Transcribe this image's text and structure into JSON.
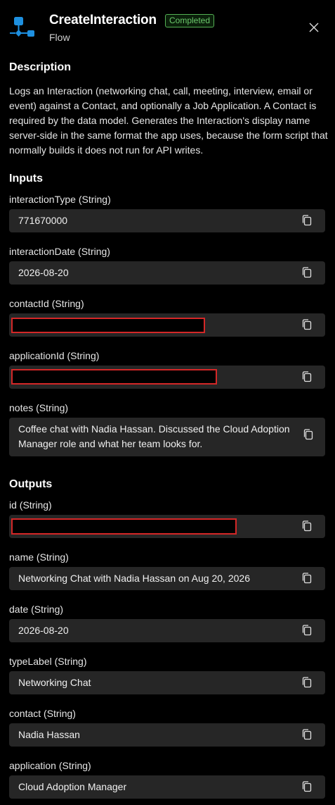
{
  "header": {
    "title": "CreateInteraction",
    "status": "Completed",
    "subtitle": "Flow",
    "icon": "flow-icon",
    "accent_color": "#1e90e0",
    "status_color": "#6cc96c"
  },
  "description": {
    "heading": "Description",
    "text": "Logs an Interaction (networking chat, call, meeting, interview, email or event) against a Contact, and optionally a Job Application. A Contact is required by the data model. Generates the Interaction's display name server-side in the same format the app uses, because the form script that normally builds it does not run for API writes."
  },
  "inputs": {
    "heading": "Inputs",
    "fields": [
      {
        "label": "interactionType (String)",
        "value": "771670000"
      },
      {
        "label": "interactionDate (String)",
        "value": "2026-08-20"
      },
      {
        "label": "contactId (String)",
        "value": ""
      },
      {
        "label": "applicationId (String)",
        "value": ""
      },
      {
        "label": "notes (String)",
        "value": "Coffee chat with Nadia Hassan. Discussed the Cloud Adoption Manager role and what her team looks for."
      }
    ]
  },
  "outputs": {
    "heading": "Outputs",
    "fields": [
      {
        "label": "id (String)",
        "value": ""
      },
      {
        "label": "name (String)",
        "value": "Networking Chat with Nadia Hassan on Aug 20, 2026"
      },
      {
        "label": "date (String)",
        "value": "2026-08-20"
      },
      {
        "label": "typeLabel (String)",
        "value": "Networking Chat"
      },
      {
        "label": "contact (String)",
        "value": "Nadia Hassan"
      },
      {
        "label": "application (String)",
        "value": "Cloud Adoption Manager"
      }
    ]
  }
}
